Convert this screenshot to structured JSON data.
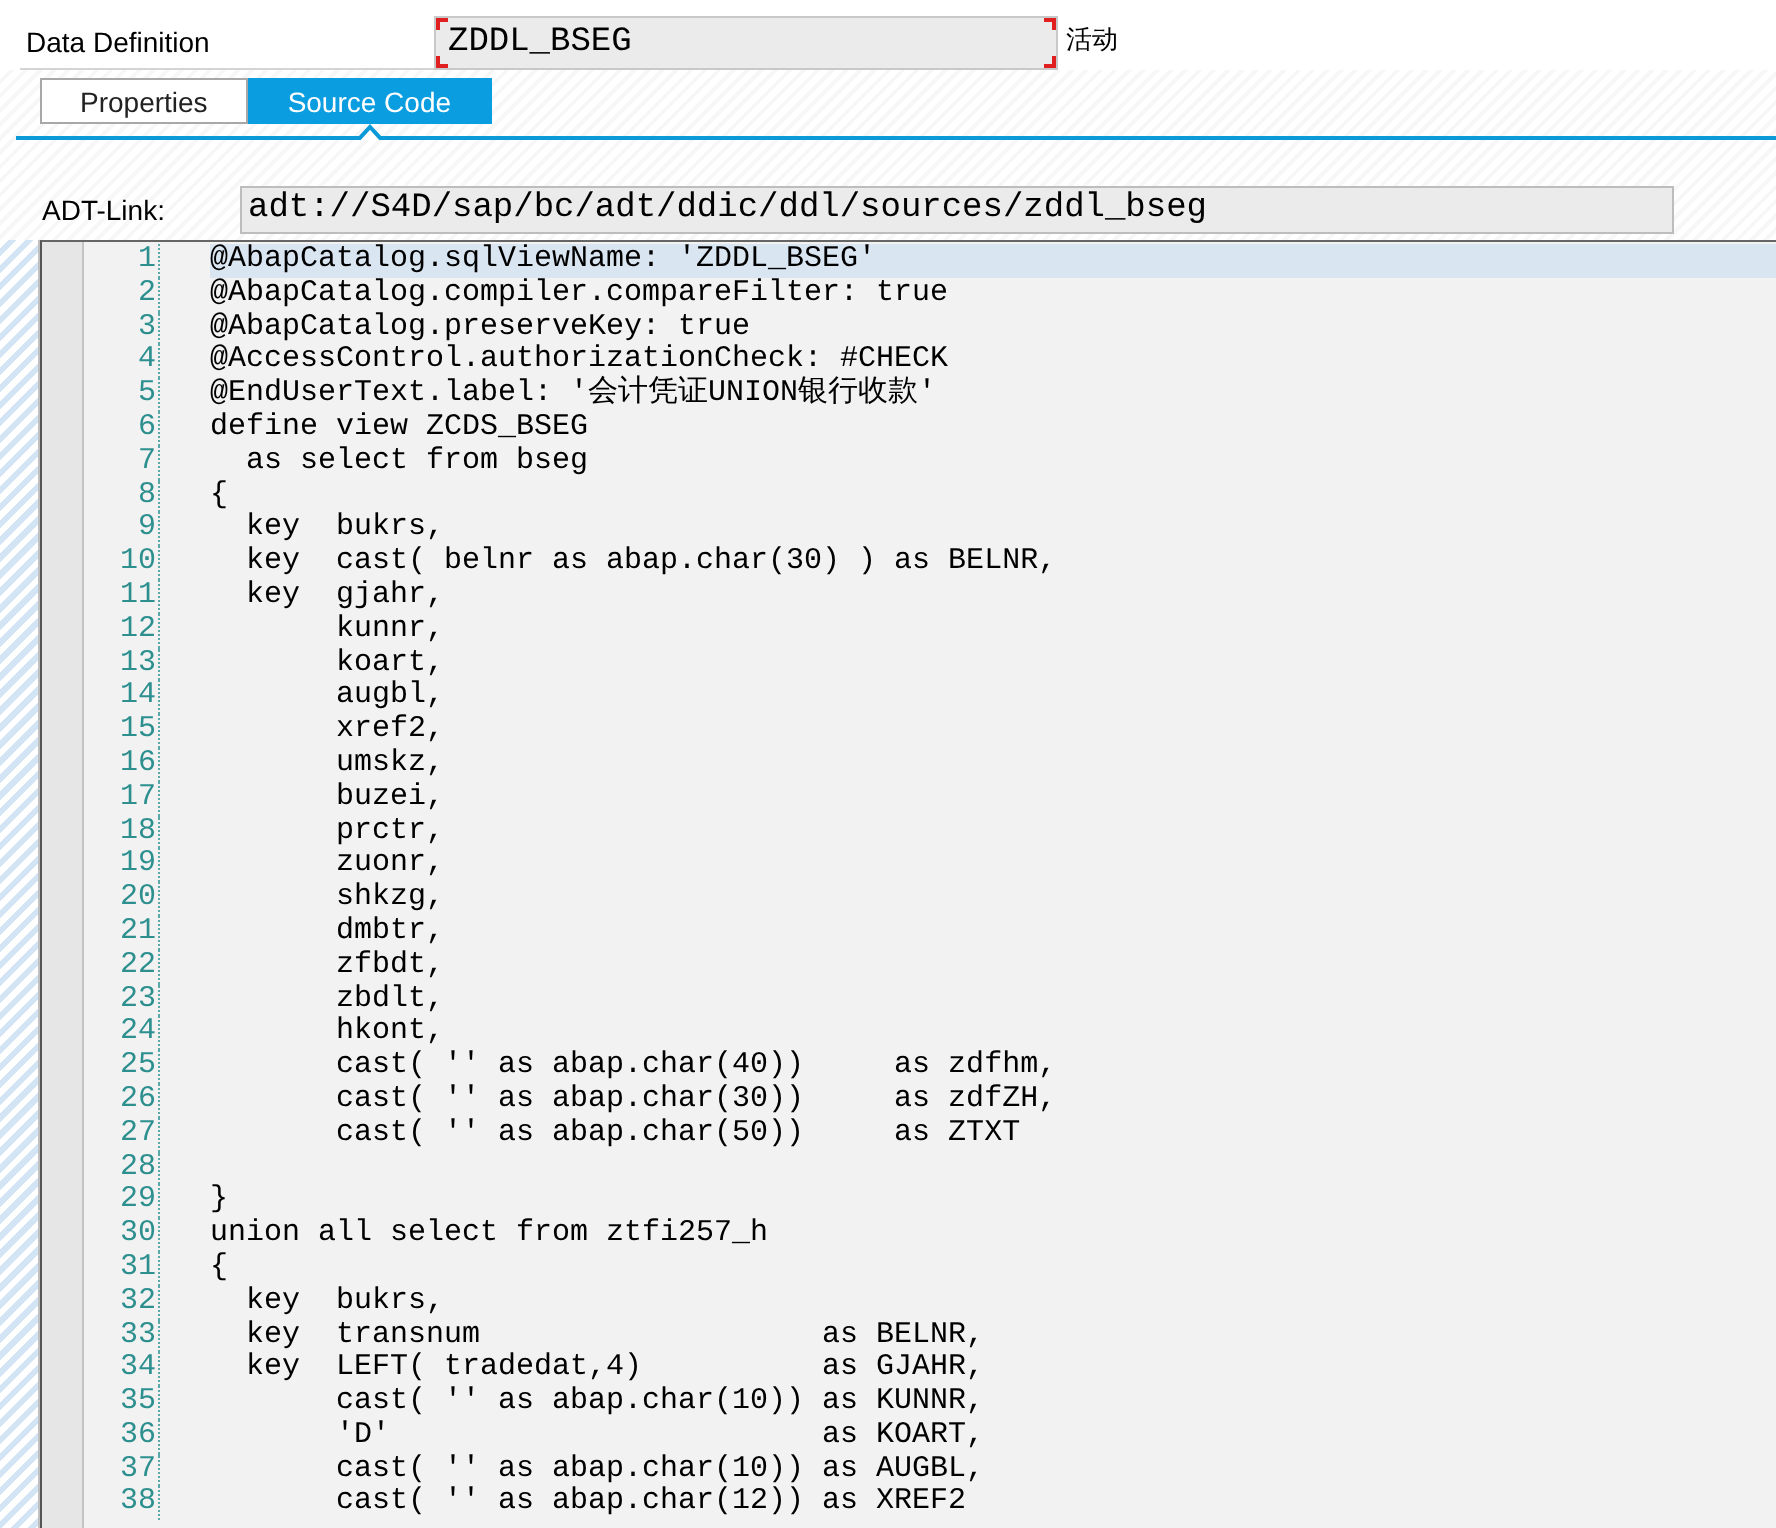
{
  "header": {
    "label": "Data Definition",
    "name_field": {
      "value": "ZDDL_BSEG",
      "required": true
    },
    "status": "活动"
  },
  "tabs": [
    {
      "label": "Properties",
      "selected": false
    },
    {
      "label": "Source Code",
      "selected": true
    }
  ],
  "adt_link": {
    "label": "ADT-Link:",
    "value": "adt://S4D/sap/bc/adt/ddic/ddl/sources/zddl_bseg"
  },
  "editor": {
    "lines": [
      {
        "number": "1",
        "text": "@AbapCatalog.sqlViewName: 'ZDDL_BSEG'",
        "current": true
      },
      {
        "number": "2",
        "text": "@AbapCatalog.compiler.compareFilter: true",
        "current": false
      },
      {
        "number": "3",
        "text": "@AbapCatalog.preserveKey: true",
        "current": false
      },
      {
        "number": "4",
        "text": "@AccessControl.authorizationCheck: #CHECK",
        "current": false
      },
      {
        "number": "5",
        "text": "@EndUserText.label: '会计凭证UNION银行收款'",
        "current": false
      },
      {
        "number": "6",
        "text": "define view ZCDS_BSEG",
        "current": false
      },
      {
        "number": "7",
        "text": "  as select from bseg",
        "current": false
      },
      {
        "number": "8",
        "text": "{",
        "current": false
      },
      {
        "number": "9",
        "text": "  key  bukrs,",
        "current": false
      },
      {
        "number": "10",
        "text": "  key  cast( belnr as abap.char(30) ) as BELNR,",
        "current": false
      },
      {
        "number": "11",
        "text": "  key  gjahr,",
        "current": false
      },
      {
        "number": "12",
        "text": "       kunnr,",
        "current": false
      },
      {
        "number": "13",
        "text": "       koart,",
        "current": false
      },
      {
        "number": "14",
        "text": "       augbl,",
        "current": false
      },
      {
        "number": "15",
        "text": "       xref2,",
        "current": false
      },
      {
        "number": "16",
        "text": "       umskz,",
        "current": false
      },
      {
        "number": "17",
        "text": "       buzei,",
        "current": false
      },
      {
        "number": "18",
        "text": "       prctr,",
        "current": false
      },
      {
        "number": "19",
        "text": "       zuonr,",
        "current": false
      },
      {
        "number": "20",
        "text": "       shkzg,",
        "current": false
      },
      {
        "number": "21",
        "text": "       dmbtr,",
        "current": false
      },
      {
        "number": "22",
        "text": "       zfbdt,",
        "current": false
      },
      {
        "number": "23",
        "text": "       zbdlt,",
        "current": false
      },
      {
        "number": "24",
        "text": "       hkont,",
        "current": false
      },
      {
        "number": "25",
        "text": "       cast( '' as abap.char(40))     as zdfhm,",
        "current": false
      },
      {
        "number": "26",
        "text": "       cast( '' as abap.char(30))     as zdfZH,",
        "current": false
      },
      {
        "number": "27",
        "text": "       cast( '' as abap.char(50))     as ZTXT",
        "current": false
      },
      {
        "number": "28",
        "current": false
      },
      {
        "number": "29",
        "text": "}",
        "current": false
      },
      {
        "number": "30",
        "text": "union all select from ztfi257_h",
        "current": false
      },
      {
        "number": "31",
        "text": "{",
        "current": false
      },
      {
        "number": "32",
        "text": "  key  bukrs,",
        "current": false
      },
      {
        "number": "33",
        "text": "  key  transnum                   as BELNR,",
        "current": false
      },
      {
        "number": "34",
        "text": "  key  LEFT( tradedat,4)          as GJAHR,",
        "current": false
      },
      {
        "number": "35",
        "text": "       cast( '' as abap.char(10)) as KUNNR,",
        "current": false
      },
      {
        "number": "36",
        "text": "       'D'                        as KOART,",
        "current": false
      },
      {
        "number": "37",
        "text": "       cast( '' as abap.char(10)) as AUGBL,",
        "current": false
      },
      {
        "number": "38",
        "text": "       cast( '' as abap.char(12)) as XREF2",
        "current": false
      }
    ]
  }
}
